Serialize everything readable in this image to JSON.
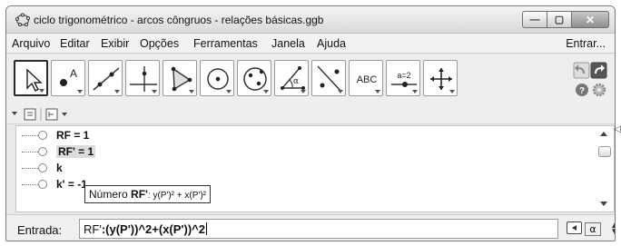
{
  "window": {
    "title": "ciclo trigonométrico - arcos côngruos - relações básicas.ggb",
    "controls": {
      "minimize_icon": "minimize-icon",
      "maximize_icon": "maximize-icon",
      "close_icon": "close-icon"
    }
  },
  "menu": {
    "items": [
      "Arquivo",
      "Editar",
      "Exibir",
      "Opções",
      "Ferramentas",
      "Janela",
      "Ajuda"
    ],
    "right": "Entrar..."
  },
  "toolbar": {
    "tools": [
      {
        "icon": "move-pointer-icon",
        "selected": true
      },
      {
        "icon": "point-icon"
      },
      {
        "icon": "line-icon"
      },
      {
        "icon": "perpendicular-line-icon"
      },
      {
        "icon": "polygon-icon"
      },
      {
        "icon": "circle-center-point-icon"
      },
      {
        "icon": "ellipse-icon"
      },
      {
        "icon": "angle-icon"
      },
      {
        "icon": "reflect-icon"
      },
      {
        "icon": "text-icon",
        "label": "ABC"
      },
      {
        "icon": "slider-icon",
        "label": "a=2"
      },
      {
        "icon": "move-view-icon"
      }
    ],
    "undo_icon": "undo-icon",
    "redo_icon": "redo-icon",
    "help_icon": "help-icon",
    "settings_icon": "settings-icon"
  },
  "algebra": {
    "rows": [
      {
        "text": "RF = 1"
      },
      {
        "text": "RF' = 1",
        "highlight": true
      },
      {
        "text": "k"
      },
      {
        "text": "k' = -1"
      }
    ],
    "tooltip": {
      "prefix": "Número",
      "name": "RF'",
      "formula": ": y(P')² + x(P')²"
    }
  },
  "input": {
    "label": "Entrada:",
    "prefix": "RF'",
    "expression": ":(y(P'))^2+(x(P'))^2",
    "alpha": "α",
    "spin": "▲▼"
  }
}
